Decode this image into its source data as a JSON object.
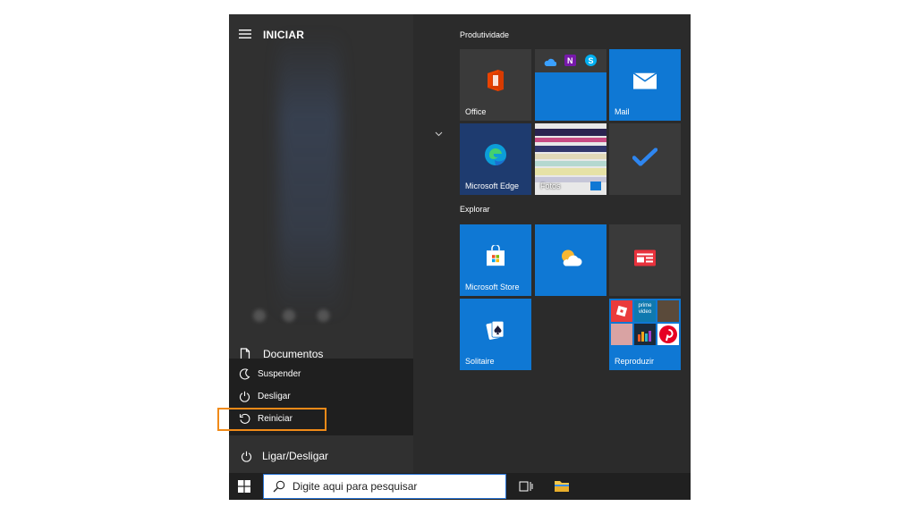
{
  "start_menu": {
    "title": "INICIAR",
    "documents_label": "Documentos",
    "power_label": "Ligar/Desligar",
    "power_options": [
      {
        "label": "Suspender",
        "icon": "moon-icon"
      },
      {
        "label": "Desligar",
        "icon": "power-icon"
      },
      {
        "label": "Reiniciar",
        "icon": "restart-icon"
      }
    ],
    "highlighted_option": "Reiniciar",
    "highlight_color": "#f08a18"
  },
  "tile_groups": [
    {
      "title": "Produtividade",
      "tiles": [
        {
          "label": "Office",
          "icon": "office-icon",
          "color": "#3a3a3a"
        },
        {
          "label": "",
          "icon": "onedrive-onenote-skype-icons",
          "color": "#0f78d4"
        },
        {
          "label": "Mail",
          "icon": "mail-icon",
          "color": "#0f78d4"
        },
        {
          "label": "Microsoft Edge",
          "icon": "edge-icon",
          "color": "#1e3b6f"
        },
        {
          "label": "Fotos",
          "icon": "photos-icon",
          "color": "#e8e8e8"
        },
        {
          "label": "",
          "icon": "todo-check-icon",
          "color": "#3a3a3a"
        }
      ]
    },
    {
      "title": "Explorar",
      "tiles": [
        {
          "label": "Microsoft Store",
          "icon": "store-icon",
          "color": "#0f78d4"
        },
        {
          "label": "",
          "icon": "weather-icon",
          "color": "#0f78d4"
        },
        {
          "label": "",
          "icon": "news-icon",
          "color": "#3a3a3a"
        },
        {
          "label": "Solitaire",
          "icon": "solitaire-icon",
          "color": "#0f78d4"
        },
        {
          "label": "Reproduzir",
          "icon": "play-folder-icon",
          "color": "#0f78d4",
          "mini_tile_text": "prime video"
        }
      ]
    }
  ],
  "taskbar": {
    "search_placeholder": "Digite aqui para pesquisar"
  }
}
